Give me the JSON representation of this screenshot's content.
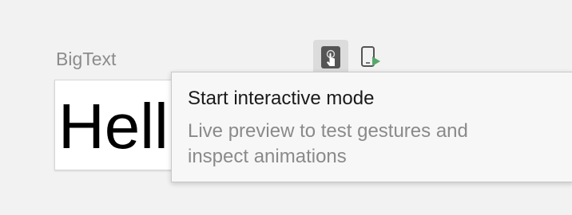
{
  "preview": {
    "label": "BigText",
    "text": "Hello"
  },
  "toolbar": {
    "interactive_icon": "interactive-mode-icon",
    "deploy_icon": "deploy-preview-icon"
  },
  "tooltip": {
    "title": "Start interactive mode",
    "description_line1": "Live preview to test gestures and",
    "description_line2": "inspect animations"
  },
  "colors": {
    "background": "#f2f2f2",
    "tooltip_background": "#f7f7f7",
    "active_button": "#dcdcdc",
    "icon_dark": "#555555",
    "play_green": "#59a869",
    "muted_text": "#8a8a8a"
  }
}
